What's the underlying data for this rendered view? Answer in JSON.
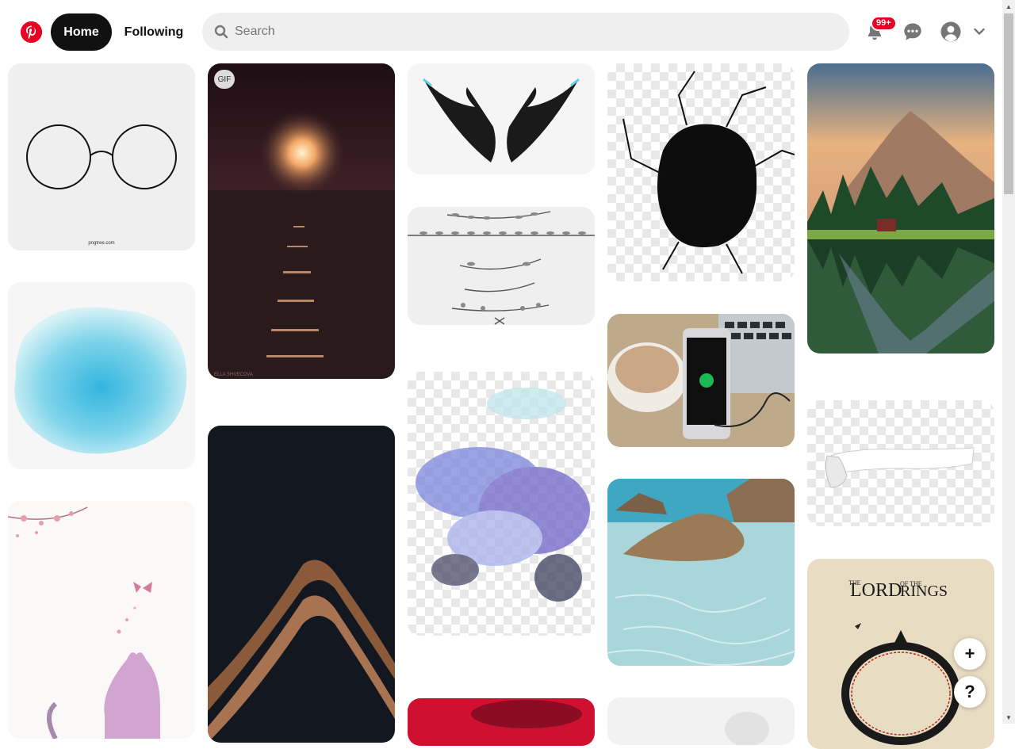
{
  "header": {
    "logo_icon": "pinterest-logo-icon",
    "nav": {
      "home_label": "Home",
      "following_label": "Following"
    },
    "search": {
      "placeholder": "Search",
      "value": ""
    },
    "notifications_badge": "99+",
    "icons": [
      "bell-icon",
      "message-icon",
      "avatar-icon",
      "chevron-down-icon"
    ]
  },
  "colors": {
    "brand": "#e60023",
    "active_nav": "#111111",
    "search_bg": "#efefef"
  },
  "pins": [
    {
      "name": "glasses-pin",
      "column": 1,
      "caption": "pngtree.com"
    },
    {
      "name": "blue-watercolor-pin",
      "column": 1
    },
    {
      "name": "pink-cat-pin",
      "column": 1
    },
    {
      "name": "sea-moon-pin",
      "column": 2,
      "badge": "GIF",
      "caption": "ELLA SHVECOVA"
    },
    {
      "name": "dark-gold-abstract-pin",
      "column": 2
    },
    {
      "name": "black-wings-pin",
      "column": 3
    },
    {
      "name": "laurel-dividers-pin",
      "column": 3
    },
    {
      "name": "purple-smoke-pin",
      "column": 3
    },
    {
      "name": "red-pin",
      "column": 3
    },
    {
      "name": "cracked-hole-pin",
      "column": 4
    },
    {
      "name": "coffee-phone-pin",
      "column": 4
    },
    {
      "name": "rocky-water-pin",
      "column": 4
    },
    {
      "name": "grey-pin",
      "column": 4
    },
    {
      "name": "mountain-lake-pin",
      "column": 5
    },
    {
      "name": "torn-paper-pin",
      "column": 5
    },
    {
      "name": "lord-of-the-rings-pin",
      "column": 5,
      "title_line1": "LORD",
      "title_small": "OF THE",
      "title_line2": "RINGS",
      "prefix": "THE"
    }
  ],
  "fab": {
    "add_label": "+",
    "help_label": "?"
  }
}
